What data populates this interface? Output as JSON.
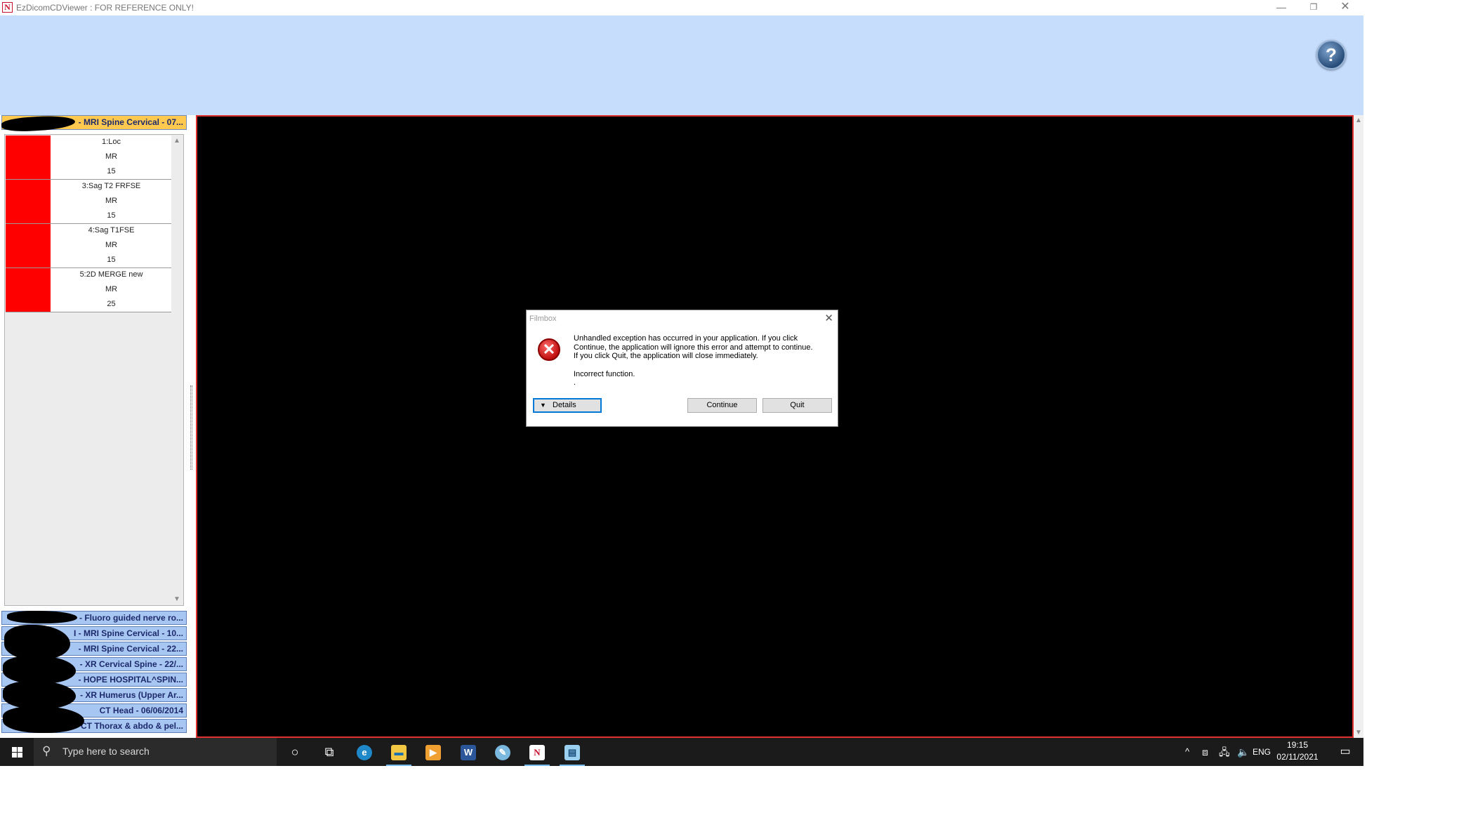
{
  "window": {
    "title": "EzDicomCDViewer : FOR REFERENCE ONLY!",
    "icon_glyph": "N",
    "controls": {
      "minimize": "—",
      "maximize": "❐",
      "close": "✕"
    }
  },
  "header": {
    "help_label": "?"
  },
  "active_study": {
    "label": "- MRI Spine Cervical - 07..."
  },
  "series": [
    {
      "name": "1:Loc",
      "modality": "MR",
      "count": "15"
    },
    {
      "name": "3:Sag T2 FRFSE",
      "modality": "MR",
      "count": "15"
    },
    {
      "name": "4:Sag T1FSE",
      "modality": "MR",
      "count": "15"
    },
    {
      "name": "5:2D MERGE new",
      "modality": "MR",
      "count": "25"
    }
  ],
  "scroll": {
    "up": "▲",
    "down": "▼"
  },
  "other_studies": [
    {
      "label": "- Fluoro guided nerve ro..."
    },
    {
      "label": "I - MRI Spine Cervical - 10..."
    },
    {
      "label": "- MRI Spine Cervical - 22..."
    },
    {
      "label": "- XR Cervical Spine - 22/..."
    },
    {
      "label": "- HOPE HOSPITAL^SPIN..."
    },
    {
      "label": "- XR Humerus (Upper Ar..."
    },
    {
      "label": "CT Head - 06/06/2014"
    },
    {
      "label": "CT Thorax & abdo & pel..."
    }
  ],
  "dialog": {
    "title": "Filmbox",
    "close": "✕",
    "error_glyph": "✕",
    "message": "Unhandled exception has occurred in your application. If you click\nContinue, the application will ignore this error and attempt to continue.\nIf you click Quit, the application will close immediately.",
    "detail": "Incorrect function.",
    "detail_trail": ".",
    "buttons": {
      "details": "Details",
      "continue": "Continue",
      "quit": "Quit"
    },
    "caret": "▼"
  },
  "taskbar": {
    "search_placeholder": "Type here to search",
    "search_glyph": "⚲",
    "cortana_glyph": "○",
    "taskview_glyph": "⧉",
    "apps": [
      {
        "name": "edge",
        "glyph": "e",
        "color": "#1e88c8"
      },
      {
        "name": "file-explorer",
        "glyph": "▬",
        "color": "#f2c744"
      },
      {
        "name": "media-player",
        "glyph": "▶",
        "color": "#f0a030"
      },
      {
        "name": "word",
        "glyph": "W",
        "color": "#2b579a"
      },
      {
        "name": "paint",
        "glyph": "✎",
        "color": "#7ab8e0"
      },
      {
        "name": "ezdicom",
        "glyph": "N",
        "color": "#ffffff"
      },
      {
        "name": "filmbox",
        "glyph": "▤",
        "color": "#9ad0f0"
      }
    ],
    "tray": {
      "chevron": "^",
      "language": "ENG"
    },
    "clock": {
      "time": "19:15",
      "date": "02/11/2021"
    },
    "notifications_glyph": "▭"
  }
}
